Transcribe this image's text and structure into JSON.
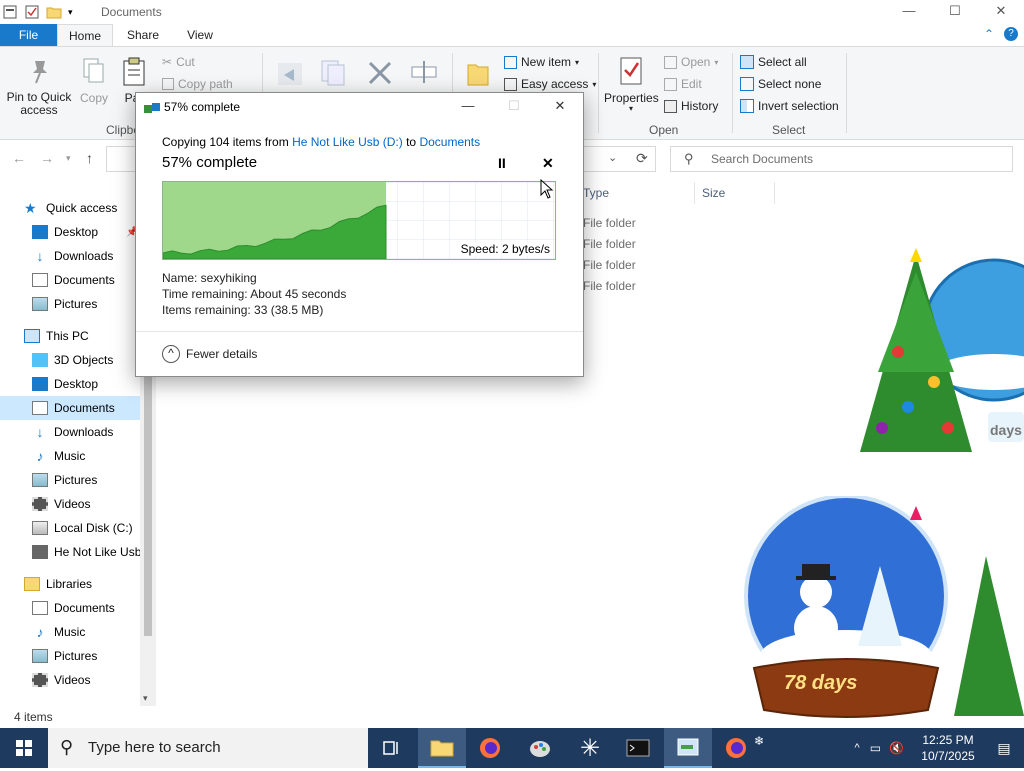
{
  "window": {
    "title": "Documents",
    "controls": {
      "minimize": "—",
      "maximize": "☐",
      "close": "✕"
    }
  },
  "ribbon": {
    "tabs": {
      "file": "File",
      "home": "Home",
      "share": "Share",
      "view": "View"
    },
    "clipboard": {
      "pin": "Pin to Quick access",
      "copy": "Copy",
      "paste": "Pa",
      "cut": "Cut",
      "copy_path": "Copy path",
      "group_label": "Clipbo"
    },
    "new": {
      "new_item": "New item",
      "easy_access": "Easy access"
    },
    "open": {
      "properties": "Properties",
      "open": "Open",
      "edit": "Edit",
      "history": "History",
      "group_label": "Open"
    },
    "select": {
      "select_all": "Select all",
      "select_none": "Select none",
      "invert": "Invert selection",
      "group_label": "Select"
    }
  },
  "search": {
    "placeholder": "Search Documents"
  },
  "columns": {
    "type": "Type",
    "size": "Size"
  },
  "files": [
    {
      "type": "File folder"
    },
    {
      "type": "File folder"
    },
    {
      "type": "File folder"
    },
    {
      "type": "File folder"
    }
  ],
  "nav": {
    "quick_access": "Quick access",
    "qa_items": [
      "Desktop",
      "Downloads",
      "Documents",
      "Pictures"
    ],
    "this_pc": "This PC",
    "pc_items": [
      "3D Objects",
      "Desktop",
      "Documents",
      "Downloads",
      "Music",
      "Pictures",
      "Videos",
      "Local Disk (C:)",
      "He Not Like Usb"
    ],
    "libraries": "Libraries",
    "lib_items": [
      "Documents",
      "Music",
      "Pictures",
      "Videos"
    ]
  },
  "status": {
    "items": "4 items"
  },
  "dialog": {
    "title": "57% complete",
    "copying_prefix": "Copying 104 items from ",
    "source": "He Not Like Usb (D:)",
    "to_word": " to ",
    "destination": "Documents",
    "percent_text": "57% complete",
    "pause": "II",
    "cancel": "✕",
    "speed": "Speed: 2 bytes/s",
    "name_line": "Name:  sexyhiking",
    "time_line": "Time remaining:  About 45 seconds",
    "items_line": "Items remaining:  33 (38.5 MB)",
    "fewer_details": "Fewer details",
    "progress_fraction": 0.57
  },
  "taskbar": {
    "search_placeholder": "Type here to search",
    "time": "12:25 PM",
    "date": "10/7/2025"
  },
  "decor": {
    "countdown": "78 days",
    "countdown_small": "days"
  },
  "colors": {
    "accent": "#1979ca",
    "progress_green": "#4caf3f",
    "taskbar": "#1e3a5f"
  }
}
